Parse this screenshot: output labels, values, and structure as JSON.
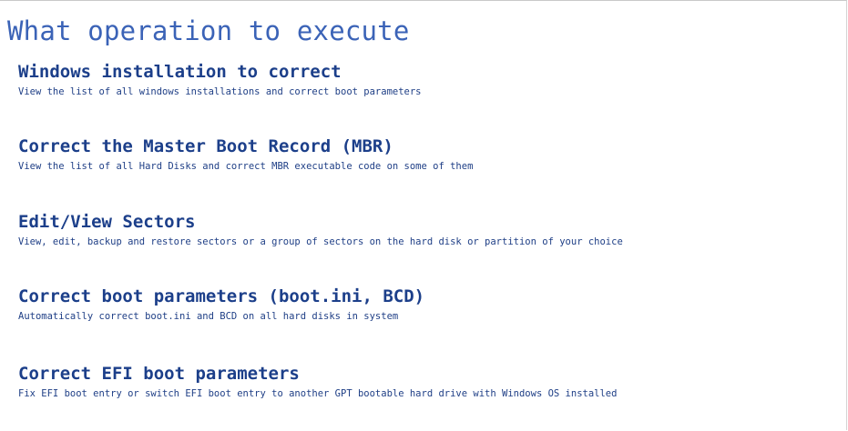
{
  "page": {
    "title": "What operation to execute"
  },
  "operations": [
    {
      "title": "Windows installation to correct",
      "description": "View the list of all windows installations and correct boot parameters"
    },
    {
      "title": "Correct the Master Boot Record (MBR)",
      "description": "View the list of all Hard Disks and correct MBR executable code on some of them"
    },
    {
      "title": "Edit/View Sectors",
      "description": "View, edit, backup and restore sectors or a group of sectors on the hard disk or partition of your choice"
    },
    {
      "title": "Correct boot parameters (boot.ini, BCD)",
      "description": "Automatically correct boot.ini and BCD on all hard disks in system"
    },
    {
      "title": "Correct EFI boot parameters",
      "description": "Fix EFI boot entry or switch EFI boot entry to another GPT bootable hard drive with Windows OS installed"
    }
  ]
}
